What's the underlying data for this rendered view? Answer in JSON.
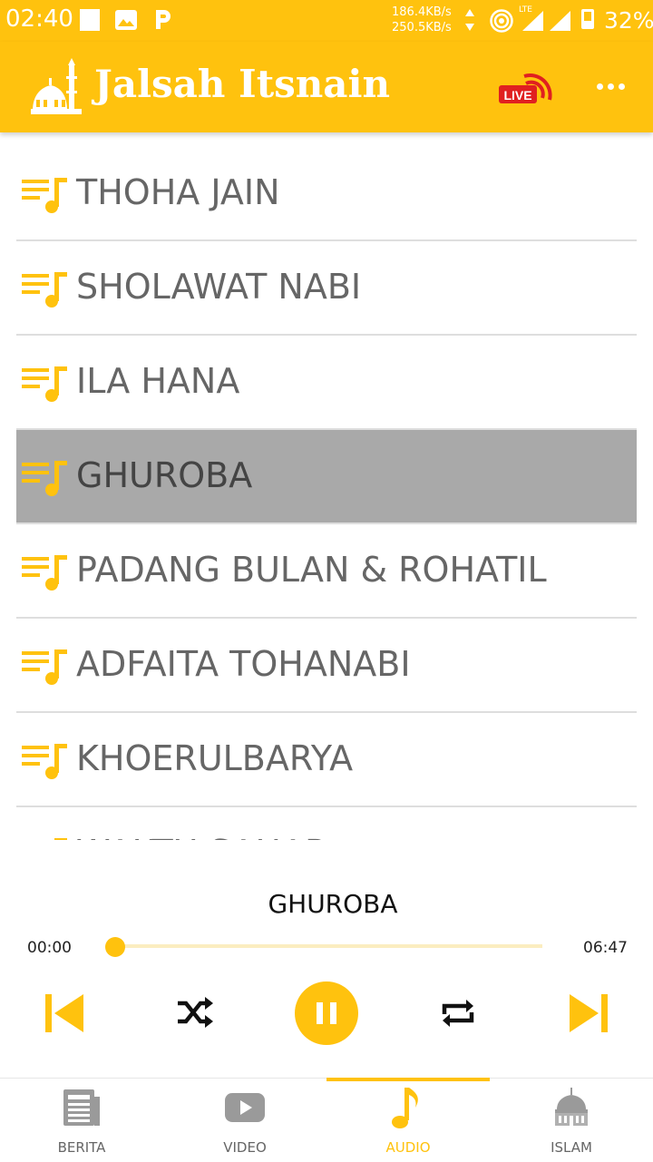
{
  "status_bar": {
    "time": "02:40",
    "speed_up": "186.4KB/s",
    "speed_down": "250.5KB/s",
    "lte": "LTE",
    "battery": "32%"
  },
  "app_bar": {
    "title": "Jalsah Itsnain",
    "live_badge": "LIVE"
  },
  "playlist": [
    {
      "label": "THOHA JAIN"
    },
    {
      "label": "SHOLAWAT NABI"
    },
    {
      "label": "ILA HANA"
    },
    {
      "label": "GHUROBA"
    },
    {
      "label": "PADANG BULAN & ROHATIL"
    },
    {
      "label": "ADFAITA TOHANABI"
    },
    {
      "label": "KHOERULBARYA"
    },
    {
      "label": "WAKTU SAHAR"
    }
  ],
  "player": {
    "now_playing": "GHUROBA",
    "current_time": "00:00",
    "duration": "06:47",
    "progress_fraction": 0.0
  },
  "bottom_nav": [
    {
      "label": "BERITA"
    },
    {
      "label": "VIDEO"
    },
    {
      "label": "AUDIO"
    },
    {
      "label": "ISLAM"
    }
  ],
  "colors": {
    "accent": "#FFC20E",
    "selected_row": "#A9A9A9",
    "live_red": "#E02020"
  }
}
